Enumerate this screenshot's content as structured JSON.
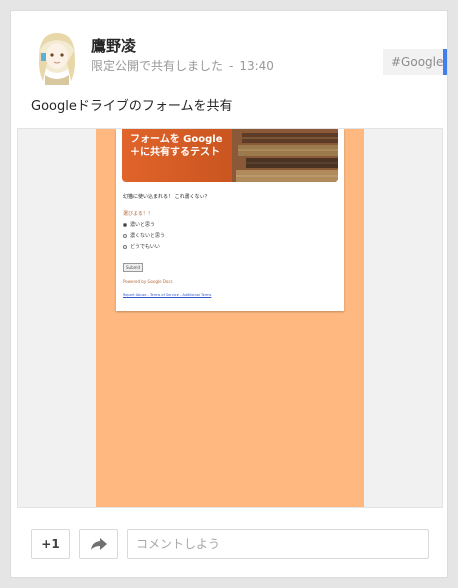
{
  "post": {
    "author": "鷹野凌",
    "visibility": "限定公開で共有しました",
    "separator": "-",
    "time": "13:40",
    "hashtag": "#Google",
    "text": "Googleドライブのフォームを共有"
  },
  "preview": {
    "banner": "フォームを Google＋に共有するテスト",
    "question": "幻猫に使い込まれる！ これ書くなぃ？",
    "question_sub": "選びよる！！",
    "options": [
      "濃いと思う",
      "濃くないと思う",
      "どうでもいい"
    ],
    "selected_option": 0,
    "submit": "Submit",
    "powered": "Powered by Google Docs",
    "links": "Report Abuse - Terms of Service - Additional Terms"
  },
  "actions": {
    "plus_one": "+1",
    "comment_placeholder": "コメントしよう"
  },
  "colors": {
    "form_background": "#ffb980",
    "banner": "#e0642b",
    "hashtag_accent": "#427fed"
  }
}
